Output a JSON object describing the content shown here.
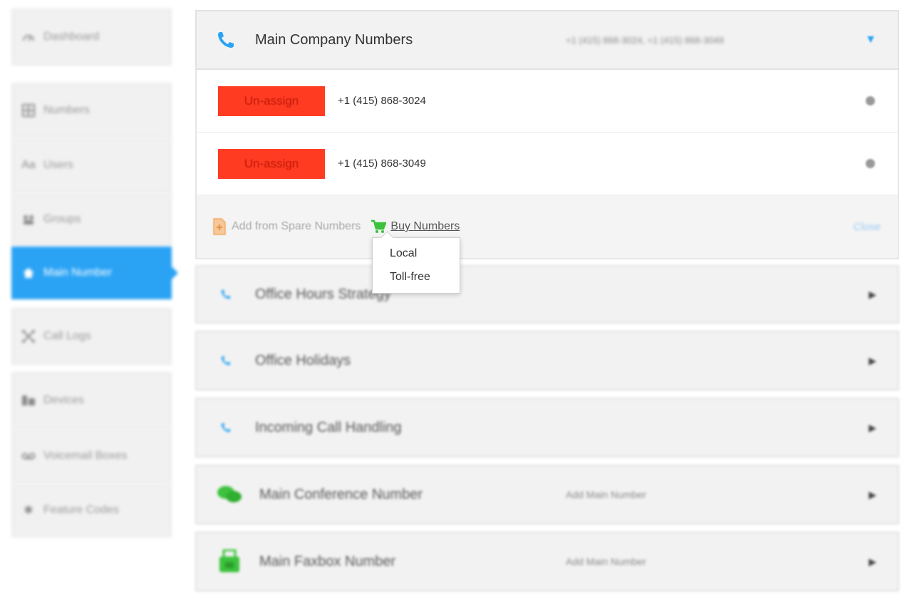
{
  "sidebar": {
    "items": [
      {
        "label": "Dashboard",
        "icon": "gauge-icon"
      },
      {
        "label": "Numbers",
        "icon": "grid-icon"
      },
      {
        "label": "Users",
        "icon": "users-icon"
      },
      {
        "label": "Groups",
        "icon": "groups-icon"
      },
      {
        "label": "Main Number",
        "icon": "home-icon"
      },
      {
        "label": "Call Logs",
        "icon": "call-logs-icon"
      },
      {
        "label": "Devices",
        "icon": "devices-icon"
      },
      {
        "label": "Voicemail Boxes",
        "icon": "voicemail-icon"
      },
      {
        "label": "Feature Codes",
        "icon": "star-icon"
      }
    ],
    "active_index": 4
  },
  "main_company": {
    "title": "Main Company Numbers",
    "summary": "+1 (415) 868-3024, +1 (415) 868-3049",
    "numbers": [
      {
        "button": "Un-assign",
        "number": "+1 (415) 868-3024"
      },
      {
        "button": "Un-assign",
        "number": "+1 (415) 868-3049"
      }
    ],
    "add_spare_label": "Add from Spare Numbers",
    "buy_label": "Buy Numbers",
    "close_label": "Close",
    "buy_menu": [
      "Local",
      "Toll-free"
    ]
  },
  "panels": [
    {
      "title": "Office Hours Strategy",
      "meta": ""
    },
    {
      "title": "Office Holidays",
      "meta": ""
    },
    {
      "title": "Incoming Call Handling",
      "meta": ""
    },
    {
      "title": "Main Conference Number",
      "meta": "Add Main Number"
    },
    {
      "title": "Main Faxbox Number",
      "meta": "Add Main Number"
    }
  ],
  "colors": {
    "accent_blue": "#2aa3f5",
    "unassign_red": "#ff3b22",
    "cart_green": "#3cc23c"
  }
}
